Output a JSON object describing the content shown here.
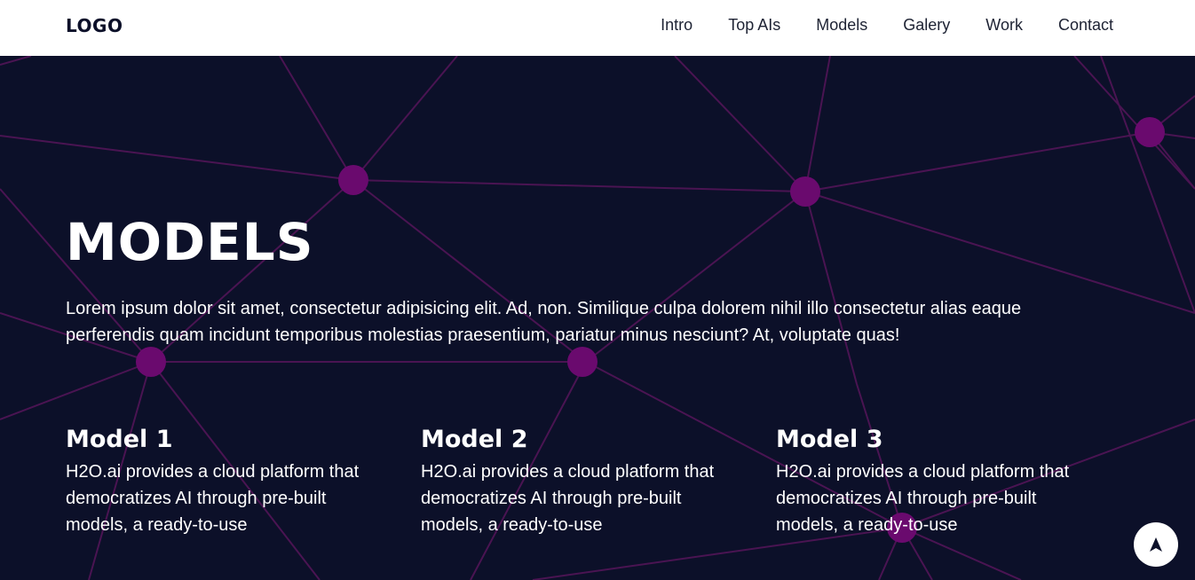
{
  "header": {
    "logo": "LOGO",
    "nav": [
      "Intro",
      "Top AIs",
      "Models",
      "Galery",
      "Work",
      "Contact"
    ]
  },
  "hero": {
    "title": "MODELS",
    "intro": "Lorem ipsum dolor sit amet, consectetur adipisicing elit. Ad, non. Similique culpa dolorem nihil illo consectetur alias eaque perferendis quam incidunt temporibus molestias praesentium, pariatur minus nesciunt? At, voluptate quas!"
  },
  "models": [
    {
      "title": "Model 1",
      "description": "H2O.ai provides a cloud platform that democratizes AI through pre-built models, a ready-to-use"
    },
    {
      "title": "Model 2",
      "description": "H2O.ai provides a cloud platform that democratizes AI through pre-built models, a ready-to-use"
    },
    {
      "title": "Model 3",
      "description": "H2O.ai provides a cloud platform that democratizes AI through pre-built models, a ready-to-use"
    }
  ],
  "colors": {
    "background": "#0c1029",
    "node": "#6a0a6e",
    "line": "#4a1452",
    "header": "#ffffff",
    "text": "#ffffff"
  },
  "icons": {
    "scroll_top": "arrow-up-icon"
  }
}
